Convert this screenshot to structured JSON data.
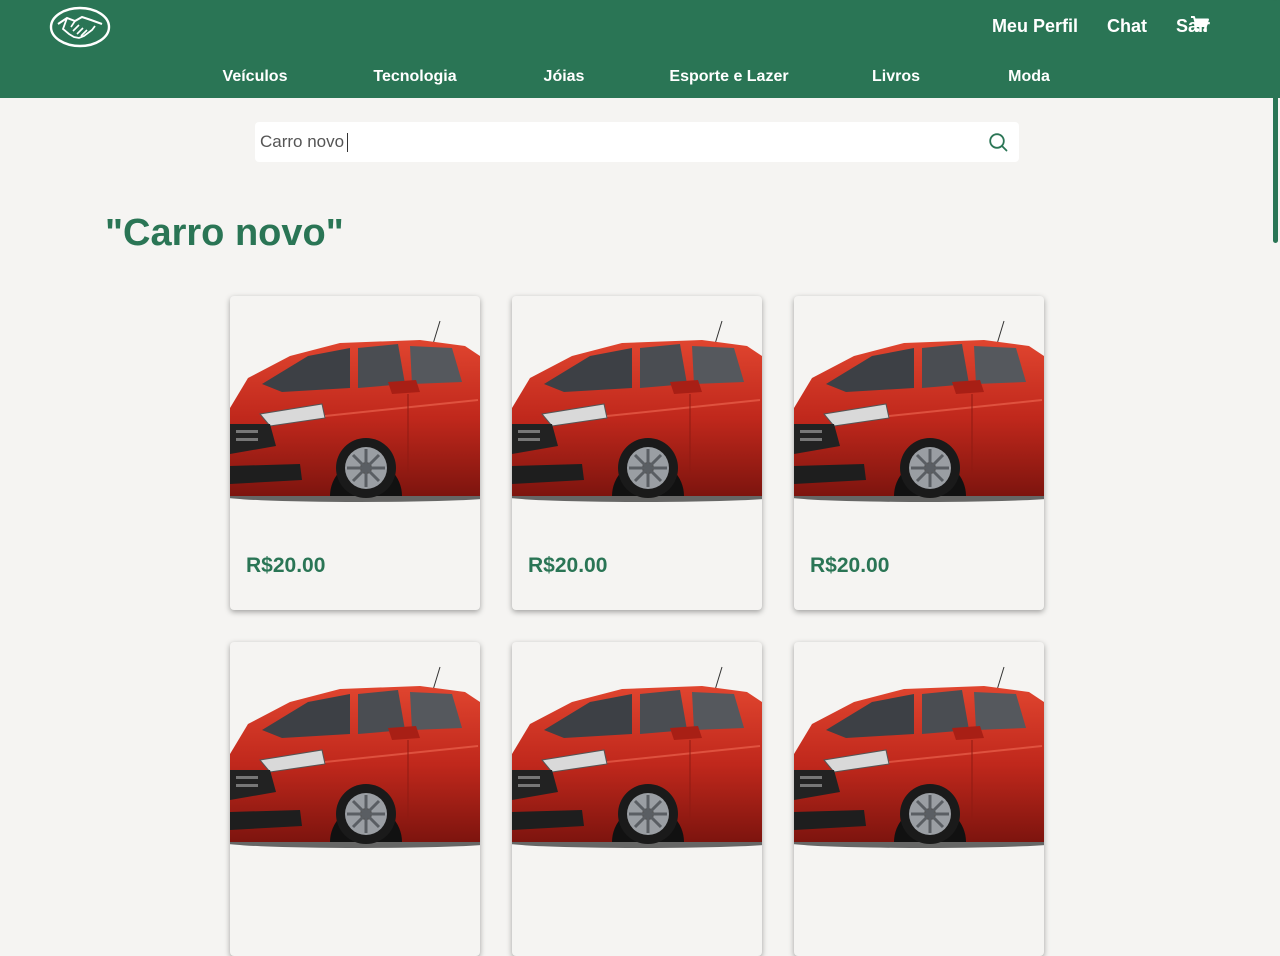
{
  "header": {
    "logo": "handshake-logo",
    "nav": [
      "Meu Perfil",
      "Chat",
      "Sair"
    ],
    "cart_icon": "cart-icon"
  },
  "categories": [
    "Veículos",
    "Tecnologia",
    "Jóias",
    "Esporte e Lazer",
    "Livros",
    "Moda"
  ],
  "search": {
    "value": "Carro novo",
    "icon": "search-icon"
  },
  "results": {
    "title": "\"Carro novo\"",
    "products": [
      {
        "price": "R$20.00"
      },
      {
        "price": "R$20.00"
      },
      {
        "price": "R$20.00"
      },
      {
        "price": ""
      },
      {
        "price": ""
      },
      {
        "price": ""
      }
    ]
  },
  "colors": {
    "brand": "#2a7555",
    "background": "#f5f4f2",
    "car": "#c0281c"
  }
}
